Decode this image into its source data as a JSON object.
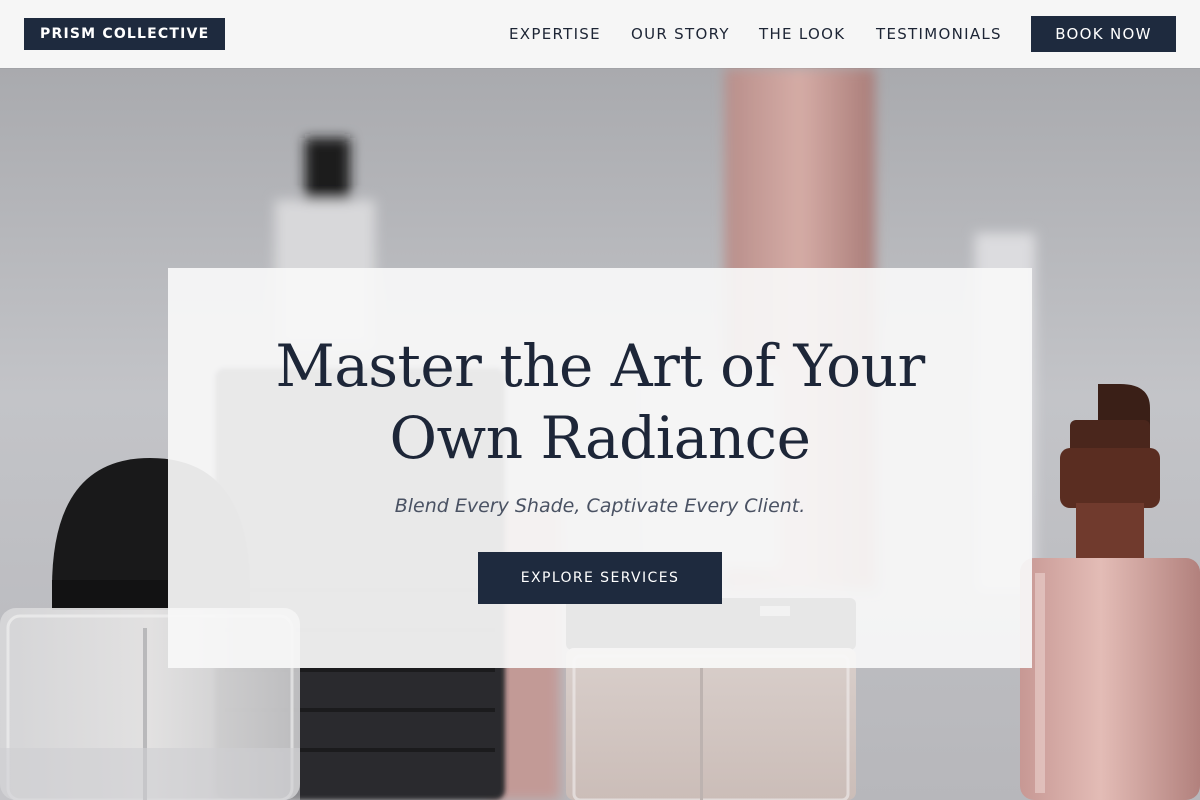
{
  "brand": {
    "name": "PRISM COLLECTIVE"
  },
  "nav": {
    "items": [
      {
        "label": "EXPERTISE"
      },
      {
        "label": "OUR STORY"
      },
      {
        "label": "THE LOOK"
      },
      {
        "label": "TESTIMONIALS"
      }
    ],
    "cta_label": "BOOK NOW"
  },
  "hero": {
    "headline_line1": "Master the Art of Your",
    "headline_line2": "Own Radiance",
    "tagline": "Blend Every Shade, Captivate Every Client.",
    "cta_label": "EXPLORE SERVICES",
    "background_image": "cosmetic-bottles-photo"
  },
  "colors": {
    "accent": "#1e2a3e",
    "header_bg": "#f6f6f6",
    "card_bg": "#f7f7f8",
    "text_dark": "#1d2638",
    "text_muted": "#4a5263"
  }
}
